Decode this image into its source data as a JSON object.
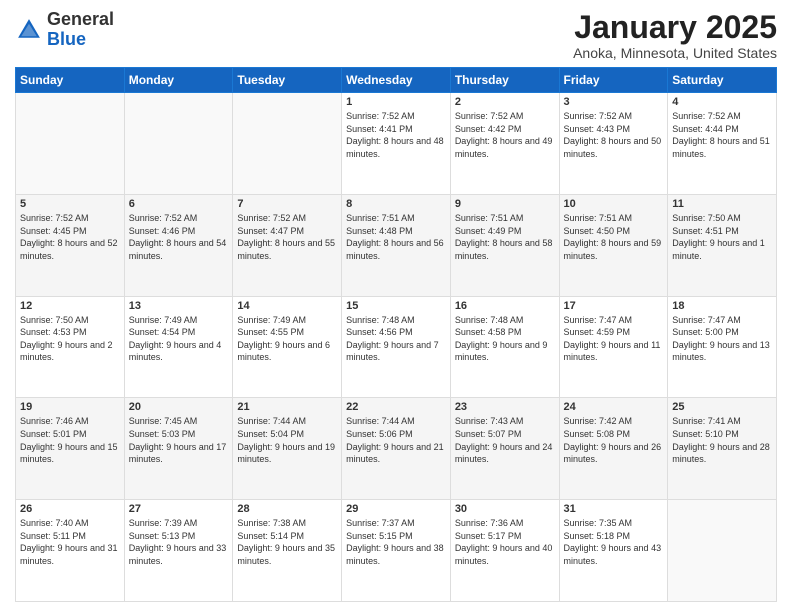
{
  "logo": {
    "general": "General",
    "blue": "Blue"
  },
  "header": {
    "month_title": "January 2025",
    "location": "Anoka, Minnesota, United States"
  },
  "weekdays": [
    "Sunday",
    "Monday",
    "Tuesday",
    "Wednesday",
    "Thursday",
    "Friday",
    "Saturday"
  ],
  "weeks": [
    [
      {
        "day": "",
        "sunrise": "",
        "sunset": "",
        "daylight": ""
      },
      {
        "day": "",
        "sunrise": "",
        "sunset": "",
        "daylight": ""
      },
      {
        "day": "",
        "sunrise": "",
        "sunset": "",
        "daylight": ""
      },
      {
        "day": "1",
        "sunrise": "Sunrise: 7:52 AM",
        "sunset": "Sunset: 4:41 PM",
        "daylight": "Daylight: 8 hours and 48 minutes."
      },
      {
        "day": "2",
        "sunrise": "Sunrise: 7:52 AM",
        "sunset": "Sunset: 4:42 PM",
        "daylight": "Daylight: 8 hours and 49 minutes."
      },
      {
        "day": "3",
        "sunrise": "Sunrise: 7:52 AM",
        "sunset": "Sunset: 4:43 PM",
        "daylight": "Daylight: 8 hours and 50 minutes."
      },
      {
        "day": "4",
        "sunrise": "Sunrise: 7:52 AM",
        "sunset": "Sunset: 4:44 PM",
        "daylight": "Daylight: 8 hours and 51 minutes."
      }
    ],
    [
      {
        "day": "5",
        "sunrise": "Sunrise: 7:52 AM",
        "sunset": "Sunset: 4:45 PM",
        "daylight": "Daylight: 8 hours and 52 minutes."
      },
      {
        "day": "6",
        "sunrise": "Sunrise: 7:52 AM",
        "sunset": "Sunset: 4:46 PM",
        "daylight": "Daylight: 8 hours and 54 minutes."
      },
      {
        "day": "7",
        "sunrise": "Sunrise: 7:52 AM",
        "sunset": "Sunset: 4:47 PM",
        "daylight": "Daylight: 8 hours and 55 minutes."
      },
      {
        "day": "8",
        "sunrise": "Sunrise: 7:51 AM",
        "sunset": "Sunset: 4:48 PM",
        "daylight": "Daylight: 8 hours and 56 minutes."
      },
      {
        "day": "9",
        "sunrise": "Sunrise: 7:51 AM",
        "sunset": "Sunset: 4:49 PM",
        "daylight": "Daylight: 8 hours and 58 minutes."
      },
      {
        "day": "10",
        "sunrise": "Sunrise: 7:51 AM",
        "sunset": "Sunset: 4:50 PM",
        "daylight": "Daylight: 8 hours and 59 minutes."
      },
      {
        "day": "11",
        "sunrise": "Sunrise: 7:50 AM",
        "sunset": "Sunset: 4:51 PM",
        "daylight": "Daylight: 9 hours and 1 minute."
      }
    ],
    [
      {
        "day": "12",
        "sunrise": "Sunrise: 7:50 AM",
        "sunset": "Sunset: 4:53 PM",
        "daylight": "Daylight: 9 hours and 2 minutes."
      },
      {
        "day": "13",
        "sunrise": "Sunrise: 7:49 AM",
        "sunset": "Sunset: 4:54 PM",
        "daylight": "Daylight: 9 hours and 4 minutes."
      },
      {
        "day": "14",
        "sunrise": "Sunrise: 7:49 AM",
        "sunset": "Sunset: 4:55 PM",
        "daylight": "Daylight: 9 hours and 6 minutes."
      },
      {
        "day": "15",
        "sunrise": "Sunrise: 7:48 AM",
        "sunset": "Sunset: 4:56 PM",
        "daylight": "Daylight: 9 hours and 7 minutes."
      },
      {
        "day": "16",
        "sunrise": "Sunrise: 7:48 AM",
        "sunset": "Sunset: 4:58 PM",
        "daylight": "Daylight: 9 hours and 9 minutes."
      },
      {
        "day": "17",
        "sunrise": "Sunrise: 7:47 AM",
        "sunset": "Sunset: 4:59 PM",
        "daylight": "Daylight: 9 hours and 11 minutes."
      },
      {
        "day": "18",
        "sunrise": "Sunrise: 7:47 AM",
        "sunset": "Sunset: 5:00 PM",
        "daylight": "Daylight: 9 hours and 13 minutes."
      }
    ],
    [
      {
        "day": "19",
        "sunrise": "Sunrise: 7:46 AM",
        "sunset": "Sunset: 5:01 PM",
        "daylight": "Daylight: 9 hours and 15 minutes."
      },
      {
        "day": "20",
        "sunrise": "Sunrise: 7:45 AM",
        "sunset": "Sunset: 5:03 PM",
        "daylight": "Daylight: 9 hours and 17 minutes."
      },
      {
        "day": "21",
        "sunrise": "Sunrise: 7:44 AM",
        "sunset": "Sunset: 5:04 PM",
        "daylight": "Daylight: 9 hours and 19 minutes."
      },
      {
        "day": "22",
        "sunrise": "Sunrise: 7:44 AM",
        "sunset": "Sunset: 5:06 PM",
        "daylight": "Daylight: 9 hours and 21 minutes."
      },
      {
        "day": "23",
        "sunrise": "Sunrise: 7:43 AM",
        "sunset": "Sunset: 5:07 PM",
        "daylight": "Daylight: 9 hours and 24 minutes."
      },
      {
        "day": "24",
        "sunrise": "Sunrise: 7:42 AM",
        "sunset": "Sunset: 5:08 PM",
        "daylight": "Daylight: 9 hours and 26 minutes."
      },
      {
        "day": "25",
        "sunrise": "Sunrise: 7:41 AM",
        "sunset": "Sunset: 5:10 PM",
        "daylight": "Daylight: 9 hours and 28 minutes."
      }
    ],
    [
      {
        "day": "26",
        "sunrise": "Sunrise: 7:40 AM",
        "sunset": "Sunset: 5:11 PM",
        "daylight": "Daylight: 9 hours and 31 minutes."
      },
      {
        "day": "27",
        "sunrise": "Sunrise: 7:39 AM",
        "sunset": "Sunset: 5:13 PM",
        "daylight": "Daylight: 9 hours and 33 minutes."
      },
      {
        "day": "28",
        "sunrise": "Sunrise: 7:38 AM",
        "sunset": "Sunset: 5:14 PM",
        "daylight": "Daylight: 9 hours and 35 minutes."
      },
      {
        "day": "29",
        "sunrise": "Sunrise: 7:37 AM",
        "sunset": "Sunset: 5:15 PM",
        "daylight": "Daylight: 9 hours and 38 minutes."
      },
      {
        "day": "30",
        "sunrise": "Sunrise: 7:36 AM",
        "sunset": "Sunset: 5:17 PM",
        "daylight": "Daylight: 9 hours and 40 minutes."
      },
      {
        "day": "31",
        "sunrise": "Sunrise: 7:35 AM",
        "sunset": "Sunset: 5:18 PM",
        "daylight": "Daylight: 9 hours and 43 minutes."
      },
      {
        "day": "",
        "sunrise": "",
        "sunset": "",
        "daylight": ""
      }
    ]
  ]
}
